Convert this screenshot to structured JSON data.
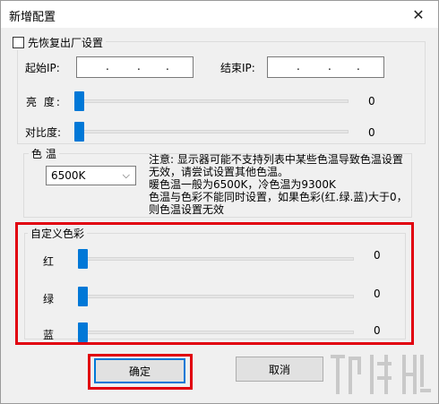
{
  "window": {
    "title": "新增配置",
    "close_glyph": "✕"
  },
  "restore_defaults": {
    "label": "先恢复出厂设置",
    "checked": false
  },
  "ip": {
    "start_label": "起始IP:",
    "end_label": "结束IP:",
    "start_value": ". . .",
    "end_value": ". . ."
  },
  "sliders": {
    "brightness": {
      "label": "亮  度:",
      "value": "0"
    },
    "contrast": {
      "label": "对比度:",
      "value": "0"
    }
  },
  "color_temp": {
    "group_title": "色 温",
    "selected": "6500K",
    "note_lines": [
      "注意: 显示器可能不支持列表中某些色温导致色温设置",
      "无效，请尝试设置其他色温。",
      "暖色温一般为6500K，冷色温为9300K",
      "色温与色彩不能同时设置，如果色彩(红.绿.蓝)大于0，",
      "则色温设置无效"
    ]
  },
  "custom_color": {
    "group_title": "自定义色彩",
    "red": {
      "label": "红",
      "value": "0"
    },
    "green": {
      "label": "绿",
      "value": "0"
    },
    "blue": {
      "label": "蓝",
      "value": "0"
    }
  },
  "buttons": {
    "ok": "确定",
    "cancel": "取消"
  },
  "colors": {
    "accent": "#0078d7",
    "highlight": "#e1000f"
  }
}
